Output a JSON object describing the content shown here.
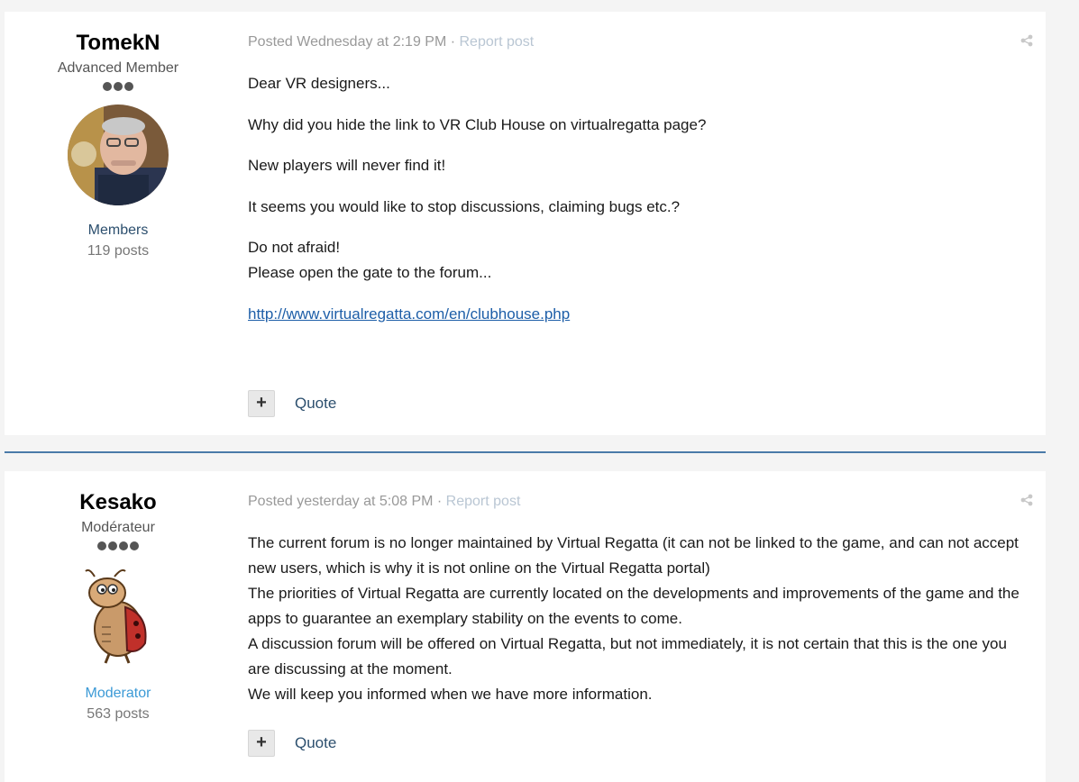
{
  "posts": [
    {
      "author": {
        "name": "TomekN",
        "title": "Advanced Member",
        "pips": 3,
        "group": "Members",
        "posts_count": "119 posts"
      },
      "meta": {
        "posted": "Posted Wednesday at 2:19 PM",
        "separator": " · ",
        "report": "Report post"
      },
      "paragraphs": [
        "Dear VR designers...",
        "Why did you hide the link to VR Club House on virtualregatta page?",
        "New players will never find it!",
        "It seems you would like to stop discussions, claiming bugs etc.?",
        "Do not afraid!",
        "Please open the gate to the forum...",
        "http://www.virtualregatta.com/en/clubhouse.php"
      ],
      "actions": {
        "plus": "+",
        "quote": "Quote"
      }
    },
    {
      "author": {
        "name": "Kesako",
        "title": "Modérateur",
        "pips": 4,
        "group": "Moderator",
        "posts_count": "563 posts"
      },
      "meta": {
        "posted": "Posted yesterday at 5:08 PM",
        "separator": " · ",
        "report": "Report post"
      },
      "paragraphs": [
        "The current forum is no longer maintained by Virtual Regatta (it can not be linked to the game, and can not accept new users, which is why it is not online on the Virtual Regatta portal)",
        "The priorities of Virtual Regatta are currently located on the developments and improvements of the game and the apps to guarantee an exemplary stability on the events to come.",
        "A discussion forum will be offered on Virtual Regatta, but not immediately, it is not certain that this is the one you are discussing at the moment.",
        "We will keep you informed when we have more information."
      ],
      "actions": {
        "plus": "+",
        "quote": "Quote"
      }
    }
  ],
  "icons": {
    "share": "share-icon",
    "plus": "plus-icon"
  },
  "colors": {
    "separator": "#4a7aa8",
    "link": "#1d5ea8",
    "moderator": "#3c9ad6",
    "members": "#2c4f6e"
  }
}
